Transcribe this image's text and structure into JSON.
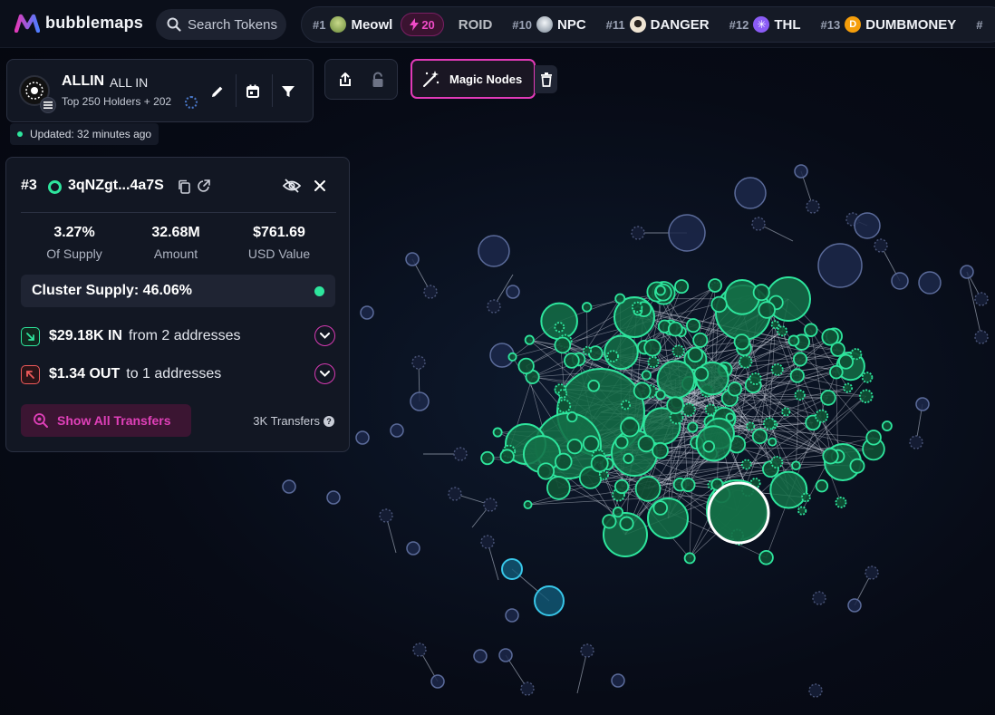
{
  "app": {
    "brand": "bubblemaps",
    "search_placeholder": "Search Tokens",
    "colors": {
      "accent": "#e23ab8",
      "green": "#2ee59d",
      "panel": "#121723",
      "background": "#070b16"
    }
  },
  "ticker": [
    {
      "rank": "#1",
      "name": "Meowl",
      "avatar_color": "#9bbf6a",
      "boost": "20"
    },
    {
      "rank": "",
      "name": "ROID",
      "avatar_color": ""
    },
    {
      "rank": "#10",
      "name": "NPC",
      "avatar_color": "#dfe6ee"
    },
    {
      "rank": "#11",
      "name": "DANGER",
      "avatar_color": "#e6d9c6"
    },
    {
      "rank": "#12",
      "name": "THL",
      "avatar_color": "#8b5cf6"
    },
    {
      "rank": "#13",
      "name": "DUMBMONEY",
      "avatar_color": "#f59e0b"
    },
    {
      "rank": "#",
      "name": "",
      "avatar_color": ""
    }
  ],
  "token": {
    "symbol": "ALLIN",
    "name": "ALL IN",
    "subtitle": "Top 250 Holders + 202",
    "updated": "Updated: 32 minutes ago"
  },
  "toolbar": {
    "magic_nodes": "Magic Nodes"
  },
  "wallet": {
    "rank": "#3",
    "address": "3qNZgt...4a7S",
    "stats": [
      {
        "value": "3.27%",
        "label": "Of Supply"
      },
      {
        "value": "32.68M",
        "label": "Amount"
      },
      {
        "value": "$761.69",
        "label": "USD Value"
      }
    ],
    "cluster_supply": "Cluster Supply: 46.06%",
    "in_amount": "$29.18K IN",
    "in_text": "from 2 addresses",
    "out_amount": "$1.34 OUT",
    "out_text": "to 1 addresses",
    "show_transfers": "Show All Transfers",
    "transfer_count": "3K Transfers"
  }
}
